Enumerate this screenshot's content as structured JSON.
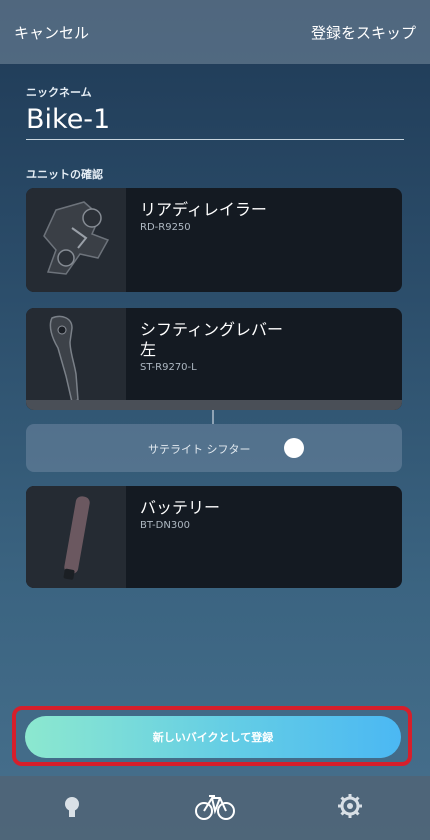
{
  "header": {
    "cancel_label": "キャンセル",
    "skip_label": "登録をスキップ"
  },
  "nickname": {
    "label": "ニックネーム",
    "value": "Bike-1"
  },
  "units": {
    "section_label": "ユニットの確認",
    "items": [
      {
        "name": "リアディレイラー",
        "model": "RD-R9250"
      },
      {
        "name_line1": "シフティングレバー",
        "name_line2": "左",
        "model": "ST-R9270-L"
      },
      {
        "name": "バッテリー",
        "model": "BT-DN300"
      }
    ],
    "satellite_label": "サテライト シフター"
  },
  "register_button": {
    "label": "新しいバイクとして登録"
  },
  "tabs": [
    {
      "icon": "lightbulb-icon"
    },
    {
      "icon": "bicycle-icon"
    },
    {
      "icon": "gear-icon"
    }
  ],
  "colors": {
    "highlight_border": "#d61f2b",
    "button_start": "#8ce8cf",
    "button_end": "#4bb8f3"
  }
}
